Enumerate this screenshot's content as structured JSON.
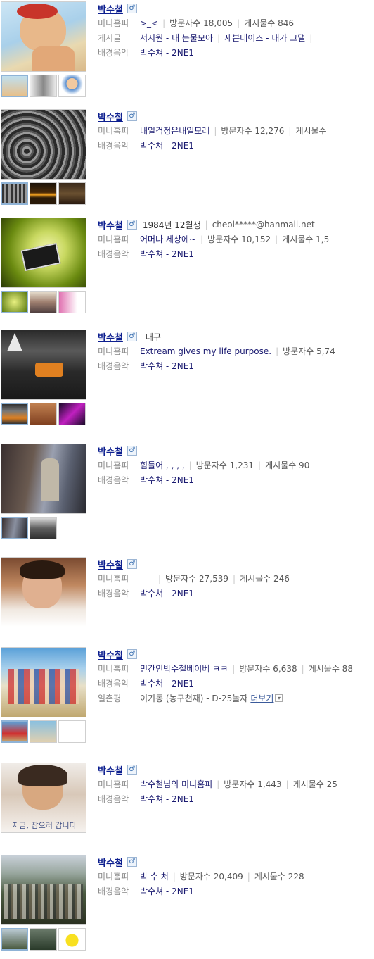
{
  "entries": [
    {
      "name": "박수철",
      "gender_icon": "♂",
      "minihompy_label": "미니홈피",
      "minihompy_title": ">_<",
      "visitors": "방문자수 18,005",
      "posts": "게시물수 846",
      "posts_label": "게시글",
      "post1": "서지원 - 내 눈물모아",
      "post2": "세븐데이즈 - 내가 그댈",
      "bgm_label": "배경음악",
      "bgm": "박수쳐 - 2NE1"
    },
    {
      "name": "박수철",
      "gender_icon": "♂",
      "minihompy_label": "미니홈피",
      "minihompy_title": "내일걱정은내일모레",
      "visitors": "방문자수 12,276",
      "posts": "게시물수",
      "bgm_label": "배경음악",
      "bgm": "박수쳐 - 2NE1"
    },
    {
      "name": "박수철",
      "gender_icon": "♂",
      "birth": "1984년 12월생",
      "email": "cheol*****@hanmail.net",
      "minihompy_label": "미니홈피",
      "minihompy_title": "어머나 세상에~",
      "visitors": "방문자수 10,152",
      "posts": "게시물수 1,5",
      "bgm_label": "배경음악",
      "bgm": "박수쳐 - 2NE1"
    },
    {
      "name": "박수철",
      "gender_icon": "♂",
      "location": "대구",
      "minihompy_label": "미니홈피",
      "minihompy_title": "Extream gives my life purpose.",
      "visitors": "방문자수 5,74",
      "bgm_label": "배경음악",
      "bgm": "박수쳐 - 2NE1"
    },
    {
      "name": "박수철",
      "gender_icon": "♂",
      "minihompy_label": "미니홈피",
      "minihompy_title": "힘들어 , , , ,",
      "visitors": "방문자수 1,231",
      "posts": "게시물수 90",
      "bgm_label": "배경음악",
      "bgm": "박수쳐 - 2NE1"
    },
    {
      "name": "박수철",
      "gender_icon": "♂",
      "minihompy_label": "미니홈피",
      "minihompy_title": "",
      "visitors": "방문자수 27,539",
      "posts": "게시물수 246",
      "bgm_label": "배경음악",
      "bgm": "박수쳐 - 2NE1"
    },
    {
      "name": "박수철",
      "gender_icon": "♂",
      "minihompy_label": "미니홈피",
      "minihompy_title": "민간인박수철베이베 ㅋㅋ",
      "visitors": "방문자수 6,638",
      "posts": "게시물수 88",
      "bgm_label": "배경음악",
      "bgm": "박수쳐 - 2NE1",
      "ilchon_label": "일촌평",
      "ilchon": "이기동 (농구천재) - D-25놀자",
      "more": "더보기",
      "more_icon": "▾"
    },
    {
      "name": "박수철",
      "gender_icon": "♂",
      "minihompy_label": "미니홈피",
      "minihompy_title": "박수철님의 미니홈피",
      "visitors": "방문자수 1,443",
      "posts": "게시물수 25",
      "bgm_label": "배경음악",
      "bgm": "박수쳐 - 2NE1"
    },
    {
      "name": "박수철",
      "gender_icon": "♂",
      "minihompy_label": "미니홈피",
      "minihompy_title": "박 수 쳐",
      "visitors": "방문자수 20,409",
      "posts": "게시물수 228",
      "bgm_label": "배경음악",
      "bgm": "박수쳐 - 2NE1"
    }
  ],
  "photo_texts": {
    "entry8_caption": "지금, 잡으러 갑니다"
  },
  "colors": {
    "name_link": "#0d1f8f",
    "label_gray": "#888888",
    "value_navy": "#1a1a70",
    "separator": "#c8c8c8"
  }
}
